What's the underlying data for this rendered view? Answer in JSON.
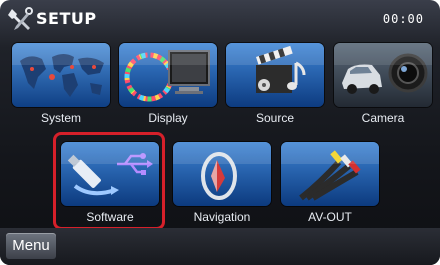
{
  "header": {
    "title": "SETUP",
    "clock": "00:00"
  },
  "tiles": {
    "system": {
      "label": "System",
      "icon": "world-map-icon"
    },
    "display": {
      "label": "Display",
      "icon": "display-monitor-icon"
    },
    "source": {
      "label": "Source",
      "icon": "clapperboard-music-icon"
    },
    "camera": {
      "label": "Camera",
      "icon": "rear-camera-car-icon"
    },
    "software": {
      "label": "Software",
      "icon": "usb-update-icon",
      "selected": true
    },
    "navigation": {
      "label": "Navigation",
      "icon": "navigation-compass-icon"
    },
    "av_out": {
      "label": "AV-OUT",
      "icon": "av-cable-icon"
    }
  },
  "footer": {
    "menu_label": "Menu"
  },
  "colors": {
    "highlight": "#d6202a",
    "tile_blue": "#1a5ca8"
  }
}
